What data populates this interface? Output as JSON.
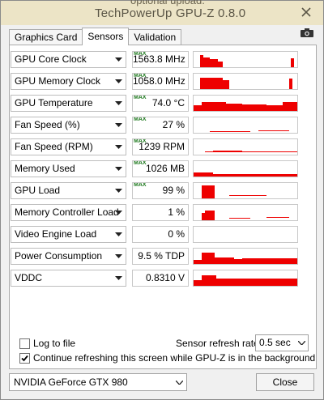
{
  "window": {
    "behind_text": "optional upload.",
    "title": "TechPowerUp GPU-Z 0.8.0"
  },
  "tabs": [
    {
      "label": "Graphics Card",
      "active": false
    },
    {
      "label": "Sensors",
      "active": true
    },
    {
      "label": "Validation",
      "active": false
    }
  ],
  "sensors": [
    {
      "name": "GPU Core Clock",
      "value": "1563.8 MHz",
      "max": true
    },
    {
      "name": "GPU Memory Clock",
      "value": "1058.0 MHz",
      "max": true
    },
    {
      "name": "GPU Temperature",
      "value": "74.0 °C",
      "max": true
    },
    {
      "name": "Fan Speed (%)",
      "value": "27 %",
      "max": true
    },
    {
      "name": "Fan Speed (RPM)",
      "value": "1239 RPM",
      "max": true
    },
    {
      "name": "Memory Used",
      "value": "1026 MB",
      "max": true
    },
    {
      "name": "GPU Load",
      "value": "99 %",
      "max": true
    },
    {
      "name": "Memory Controller Load",
      "value": "1 %",
      "max": false
    },
    {
      "name": "Video Engine Load",
      "value": "0 %",
      "max": false
    },
    {
      "name": "Power Consumption",
      "value": "9.5 % TDP",
      "max": false
    },
    {
      "name": "VDDC",
      "value": "0.8310 V",
      "max": false
    }
  ],
  "max_badge": "MAX",
  "options": {
    "log_to_file": "Log to file",
    "log_to_file_checked": false,
    "continue_refresh": "Continue refreshing this screen while GPU-Z is in the background",
    "continue_refresh_checked": true,
    "refresh_rate_label": "Sensor refresh rate:",
    "refresh_rate_value": "0.5 sec"
  },
  "gpu_select_value": "NVIDIA GeForce GTX 980",
  "close_label": "Close",
  "colors": {
    "graph": "#ee0000",
    "max_badge": "#1f7a1f"
  }
}
